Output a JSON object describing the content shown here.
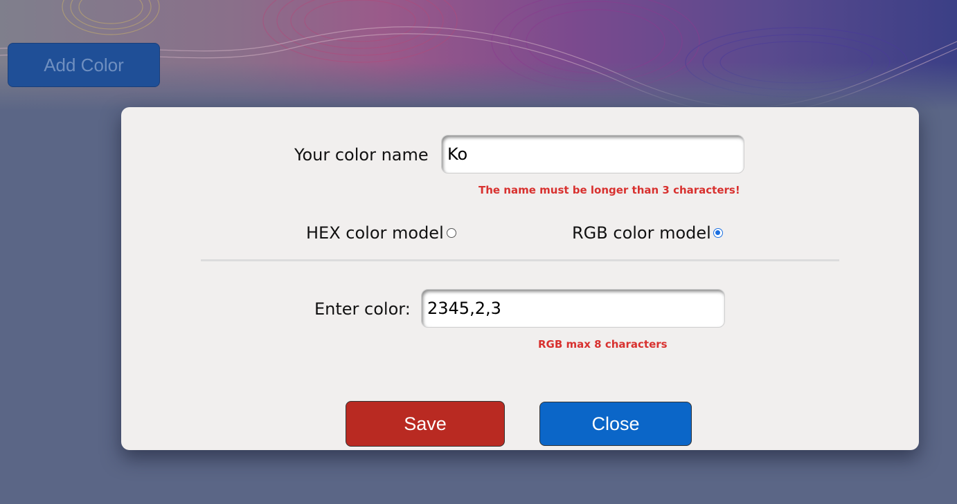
{
  "page": {
    "add_color_label": "Add Color"
  },
  "modal": {
    "name_label": "Your color name",
    "name_value": "Ko",
    "name_error": "The name must be longer than 3 characters!",
    "hex_label": "HEX color model",
    "rgb_label": "RGB color model",
    "selected_model": "RGB",
    "color_label": "Enter color:",
    "color_value": "2345,2,3",
    "color_error": "RGB max 8 characters",
    "save_label": "Save",
    "close_label": "Close"
  },
  "colors": {
    "page_background": "#5b6686",
    "modal_background": "#f1efee",
    "error_text": "#d8312f",
    "save_button": "#b92a22",
    "close_button": "#0b66c8",
    "add_button": "#1f4f97",
    "radio_selected": "#1b6fe0"
  },
  "icons": {
    "hex_radio": "radio-unchecked-icon",
    "rgb_radio": "radio-checked-icon"
  }
}
